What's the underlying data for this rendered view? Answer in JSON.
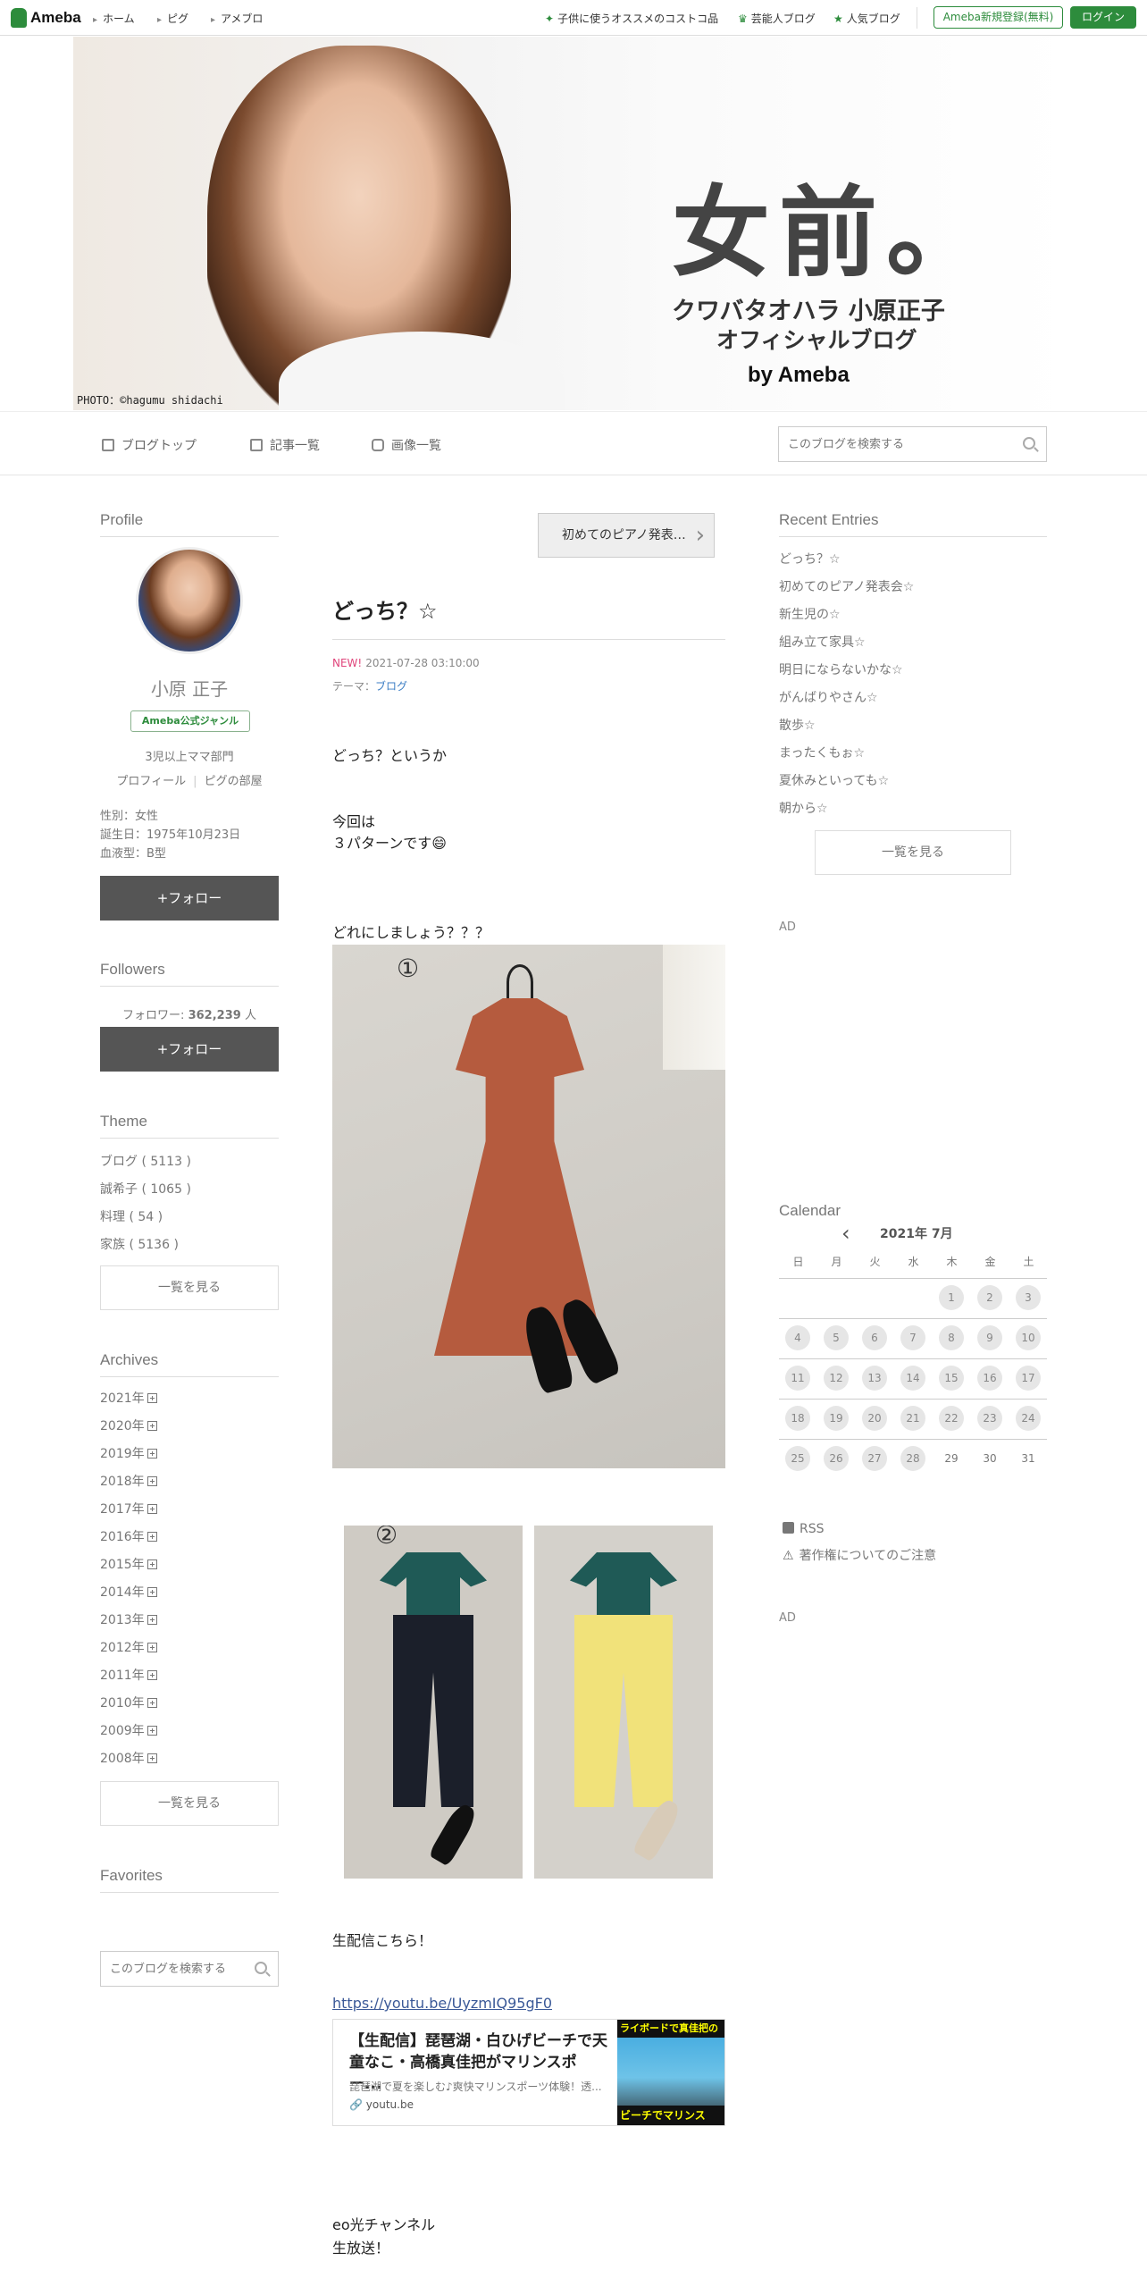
{
  "topbar": {
    "logo": "Ameba",
    "nav": [
      "ホーム",
      "ピグ",
      "アメブロ"
    ],
    "links": [
      "子供に使うオススメのコストコ品",
      "芸能人ブログ",
      "人気ブログ"
    ],
    "register": "Ameba新規登録(無料)",
    "login": "ログイン"
  },
  "header": {
    "title": "女前。",
    "sub1": "クワバタオハラ 小原正子",
    "sub2": "オフィシャルブログ",
    "by": "by Ameba",
    "credit": "PHOTO：©hagumu shidachi"
  },
  "subnav": {
    "items": [
      "ブログトップ",
      "記事一覧",
      "画像一覧"
    ],
    "search_placeholder": "このブログを検索する"
  },
  "profile": {
    "heading": "Profile",
    "name": "小原 正子",
    "badge": "Ameba公式ジャンル",
    "genre": "3児以上ママ部門",
    "link_profile": "プロフィール",
    "link_room": "ピグの部屋",
    "sex": "性別：女性",
    "birthday": "誕生日：1975年10月23日",
    "blood": "血液型：B型",
    "follow": "+フォロー"
  },
  "followers": {
    "heading": "Followers",
    "label": "フォロワー:",
    "count": "362,239",
    "unit": "人",
    "follow": "+フォロー"
  },
  "theme": {
    "heading": "Theme",
    "items": [
      "ブログ ( 5113 )",
      "誠希子 ( 1065 )",
      "料理 ( 54 )",
      "家族 ( 5136 )"
    ],
    "more": "一覧を見る"
  },
  "archives": {
    "heading": "Archives",
    "items": [
      "2021年",
      "2020年",
      "2019年",
      "2018年",
      "2017年",
      "2016年",
      "2015年",
      "2014年",
      "2013年",
      "2012年",
      "2011年",
      "2010年",
      "2009年",
      "2008年"
    ],
    "more": "一覧を見る"
  },
  "favorites": {
    "heading": "Favorites",
    "search_placeholder": "このブログを検索する"
  },
  "entry": {
    "prev": "初めてのピアノ発表…",
    "title": "どっち？☆",
    "new": "NEW!",
    "date": "2021-07-28 03:10:00",
    "theme_label": "テーマ：",
    "theme": "ブログ",
    "p1": "どっち？というか",
    "p2": "今回は",
    "p3": "３パターンです😄",
    "p4": "どれにしましょう？？？",
    "num1": "①",
    "num2": "②",
    "p5": "生配信こちら！",
    "link": "https://youtu.be/UyzmIQ95gF0",
    "card_title": "【生配信】琵琶湖・白ひげビーチで天童なこ・高橋真佳把がマリンスポー...",
    "card_desc": "琵琶湖で夏を楽しむ♪爽快マリンスポーツ体験！透...",
    "card_url": "youtu.be",
    "card_img_top": "ライボードで真佳把の",
    "card_img_bottom": "ビーチでマリンス",
    "p6": "eo光チャンネル",
    "p7": "生放送！"
  },
  "recent": {
    "heading": "Recent Entries",
    "items": [
      "どっち？☆",
      "初めてのピアノ発表会☆",
      "新生児の☆",
      "組み立て家具☆",
      "明日にならないかな☆",
      "がんばりやさん☆",
      "散歩☆",
      "まったくもぉ☆",
      "夏休みといっても☆",
      "朝から☆"
    ],
    "more": "一覧を見る"
  },
  "ad1": "AD",
  "ad2": "AD",
  "calendar": {
    "heading": "Calendar",
    "month": "2021年 7月",
    "dow": [
      "日",
      "月",
      "火",
      "水",
      "木",
      "金",
      "土"
    ],
    "weeks": [
      [
        null,
        null,
        null,
        null,
        "1",
        "2",
        "3"
      ],
      [
        "4",
        "5",
        "6",
        "7",
        "8",
        "9",
        "10"
      ],
      [
        "11",
        "12",
        "13",
        "14",
        "15",
        "16",
        "17"
      ],
      [
        "18",
        "19",
        "20",
        "21",
        "22",
        "23",
        "24"
      ],
      [
        "25",
        "26",
        "27",
        "28",
        "29",
        "30",
        "31"
      ]
    ],
    "last_entry_day": 28
  },
  "rss": "RSS",
  "copyright": "著作権についてのご注意"
}
